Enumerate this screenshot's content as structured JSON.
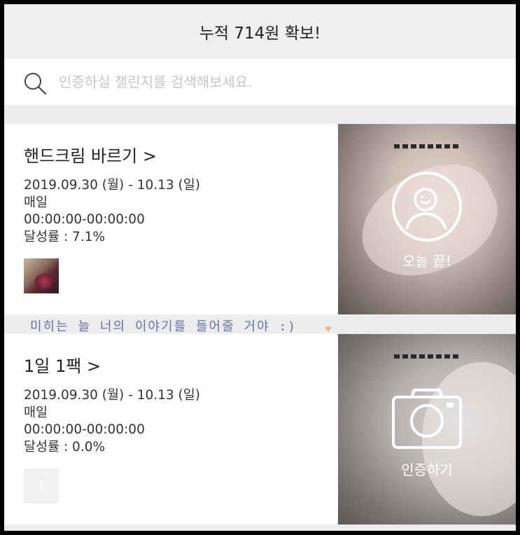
{
  "header": {
    "title": "누적 714원 확보!"
  },
  "search": {
    "placeholder": "인증하실 챌린지를 검색해보세요.",
    "icon": "search-icon"
  },
  "challenges": [
    {
      "title": "핸드크림 바르기 >",
      "period": "2019.09.30 (월) - 10.13 (일)",
      "frequency": "매일",
      "time_range": "00:00:00-00:00:00",
      "achievement": "달성률 : 7.1%",
      "status_label": "오늘 끝!",
      "status_icon": "profile-circle-icon"
    },
    {
      "title": "1일 1팩   >",
      "period": "2019.09.30 (월) - 10.13 (일)",
      "frequency": "매일",
      "time_range": "00:00:00-00:00:00",
      "achievement": "달성률 : 0.0%",
      "thumbnail_count": "1",
      "status_label": "인증하기",
      "status_icon": "camera-icon"
    }
  ],
  "handwritten_note": "미히는 늘 너의 이야기를 들어줄 거야 :)",
  "colors": {
    "background": "#ececec",
    "card": "#ffffff",
    "text": "#222222",
    "placeholder": "#c6c6c6"
  }
}
